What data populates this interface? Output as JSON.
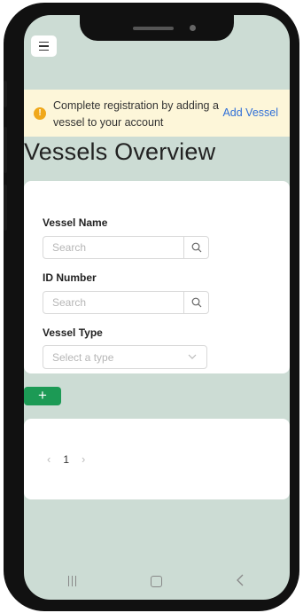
{
  "header": {
    "menu_icon": "hamburger-menu-icon"
  },
  "banner": {
    "icon": "warning-circle-icon",
    "icon_color": "#f0a81b",
    "message": "Complete registration by adding a vessel to your account",
    "action_label": "Add Vessel",
    "action_color": "#2f6fd8"
  },
  "page": {
    "title": "Vessels Overview"
  },
  "filters": {
    "vessel_name": {
      "label": "Vessel Name",
      "placeholder": "Search"
    },
    "id_number": {
      "label": "ID Number",
      "placeholder": "Search"
    },
    "vessel_type": {
      "label": "Vessel Type",
      "placeholder": "Select a type"
    }
  },
  "actions": {
    "add_label": "+",
    "add_color": "#1c9a55"
  },
  "pagination": {
    "current_page": "1",
    "prev_icon": "chevron-left-icon",
    "next_icon": "chevron-right-icon"
  },
  "system_nav": {
    "recents_icon": "recents-icon",
    "home_icon": "home-icon",
    "back_icon": "back-icon"
  }
}
